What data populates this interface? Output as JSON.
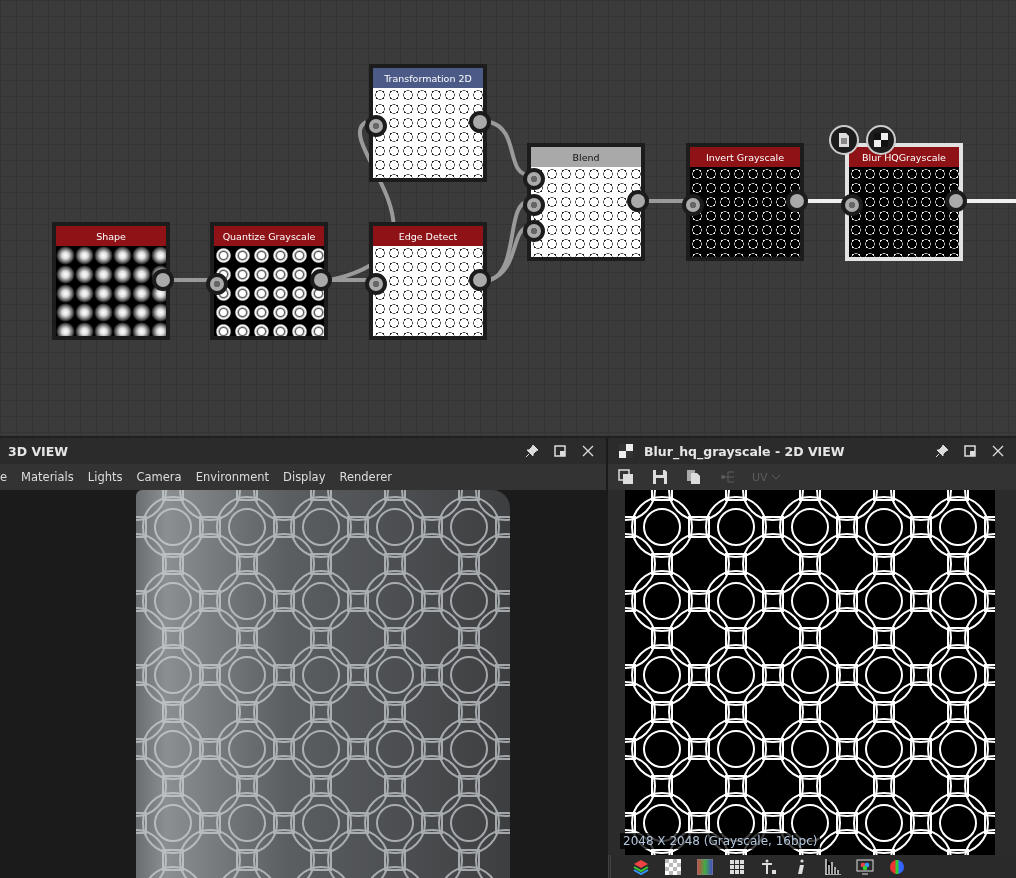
{
  "graph": {
    "nodes": [
      {
        "title": "Shape",
        "kind": "generator",
        "color": "#8e1216",
        "preview": {
          "kind": "dots"
        },
        "selected": false
      },
      {
        "title": "Quantize Grayscale",
        "kind": "filter",
        "color": "#8e1216",
        "preview": {
          "kind": "rings"
        },
        "selected": false
      },
      {
        "title": "Transformation 2D",
        "kind": "filter",
        "color": "#4b5a86",
        "preview": {
          "kind": "lacelight"
        },
        "selected": false
      },
      {
        "title": "Edge Detect",
        "kind": "filter",
        "color": "#8e1216",
        "preview": {
          "kind": "lacelight"
        },
        "selected": false
      },
      {
        "title": "Blend",
        "kind": "blend",
        "color": "#a9a9a9",
        "preview": {
          "kind": "lacelight"
        },
        "selected": false
      },
      {
        "title": "Invert Grayscale",
        "kind": "filter",
        "color": "#8e1216",
        "preview": {
          "kind": "lacedark"
        },
        "selected": false
      },
      {
        "title": "Blur HQGrayscale",
        "kind": "filter",
        "color": "#8e1216",
        "preview": {
          "kind": "lacedark"
        },
        "selected": true
      }
    ]
  },
  "view_3d": {
    "title": "3D VIEW",
    "menu": [
      "e",
      "Materials",
      "Lights",
      "Camera",
      "Environment",
      "Display",
      "Renderer"
    ]
  },
  "view_2d": {
    "title": "Blur_hq_grayscale - 2D VIEW",
    "uv": {
      "label": "UV",
      "disabled": true
    },
    "image_info": "2048 X 2048 (Grayscale, 16bpc)"
  }
}
